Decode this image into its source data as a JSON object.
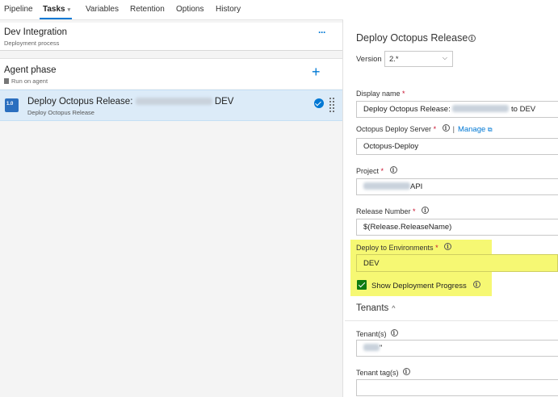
{
  "tabs": [
    {
      "label": "Pipeline"
    },
    {
      "label": "Tasks",
      "chevron": "▾"
    },
    {
      "label": "Variables"
    },
    {
      "label": "Retention"
    },
    {
      "label": "Options"
    },
    {
      "label": "History"
    }
  ],
  "stage": {
    "title": "Dev Integration",
    "subtitle": "Deployment process",
    "more": "···"
  },
  "phase": {
    "title": "Agent phase",
    "subtitle": "Run on agent",
    "add": "+"
  },
  "task": {
    "icon_text": "1.0",
    "title_prefix": "Deploy Octopus Release:",
    "title_suffix": "DEV",
    "subtitle": "Deploy Octopus Release"
  },
  "details": {
    "title": "Deploy Octopus Release",
    "version_label": "Version",
    "version_value": "2.*",
    "display_name": {
      "label": "Display name",
      "required": "*",
      "value_prefix": "Deploy Octopus Release:",
      "value_suffix": "to DEV"
    },
    "server": {
      "label": "Octopus Deploy Server",
      "required": "*",
      "manage": "Manage",
      "separator": "|",
      "value": "Octopus-Deploy"
    },
    "project": {
      "label": "Project",
      "required": "*",
      "value_suffix": "API"
    },
    "release_number": {
      "label": "Release Number",
      "required": "*",
      "value": "$(Release.ReleaseName)"
    },
    "environments": {
      "label": "Deploy to Environments",
      "required": "*",
      "value": "DEV"
    },
    "show_progress": {
      "label": "Show Deployment Progress",
      "checked": true
    },
    "tenants_section": {
      "label": "Tenants",
      "chevron": "^"
    },
    "tenants": {
      "label": "Tenant(s)",
      "value_suffix": "\""
    },
    "tenant_tags": {
      "label": "Tenant tag(s)",
      "value": ""
    }
  },
  "colors": {
    "accent": "#0078d4",
    "highlight": "#f6f873",
    "selected_row": "#dcebf8",
    "check_green": "#107c10",
    "required": "#c8102e"
  },
  "icons": [
    "chevron-down-icon",
    "more-icon",
    "agent-icon",
    "add-icon",
    "task-icon",
    "check-circle-icon",
    "drag-handle-icon",
    "info-icon",
    "external-link-icon",
    "checkbox-icon",
    "chevron-up-icon"
  ]
}
